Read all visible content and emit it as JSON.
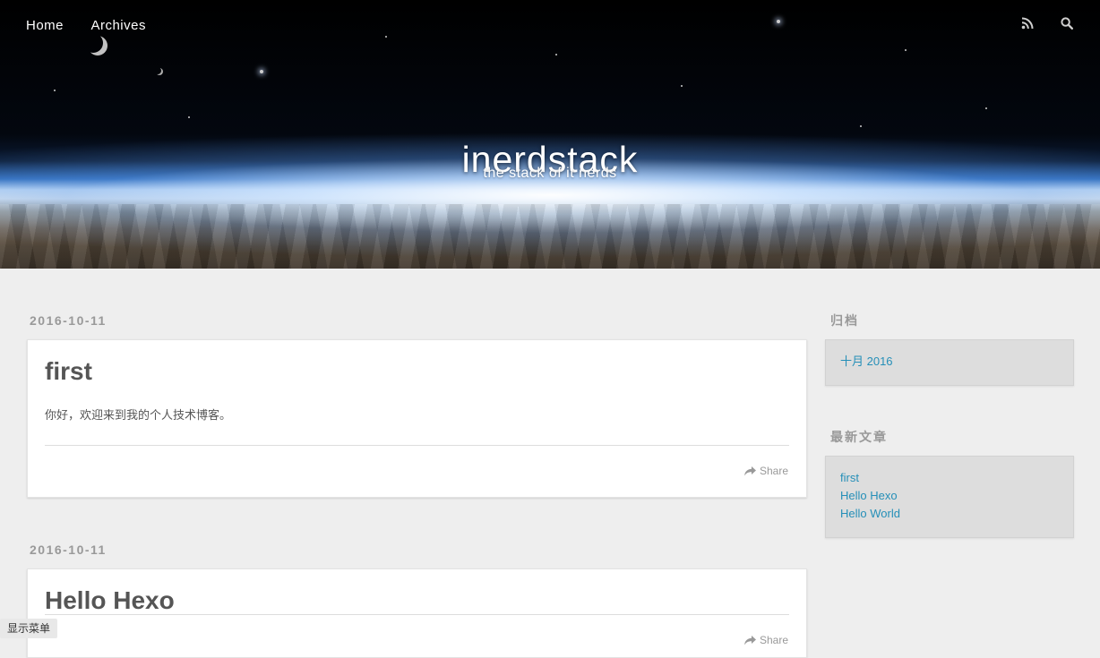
{
  "nav": {
    "items": [
      {
        "label": "Home"
      },
      {
        "label": "Archives"
      }
    ],
    "rss_icon": "rss-icon",
    "search_icon": "search-icon"
  },
  "header": {
    "title": "inerdstack",
    "subtitle": "the stack of it nerds"
  },
  "posts": [
    {
      "date": "2016-10-11",
      "title": "first",
      "excerpt": "你好，欢迎来到我的个人技术博客。",
      "share_label": "Share"
    },
    {
      "date": "2016-10-11",
      "title": "Hello Hexo",
      "share_label": "Share"
    }
  ],
  "sidebar": {
    "archives": {
      "title": "归档",
      "items": [
        {
          "label": "十月 2016"
        }
      ]
    },
    "recent": {
      "title": "最新文章",
      "items": [
        {
          "label": "first"
        },
        {
          "label": "Hello Hexo"
        },
        {
          "label": "Hello World"
        }
      ]
    }
  },
  "menu_toggle": {
    "label": "显示菜单"
  }
}
